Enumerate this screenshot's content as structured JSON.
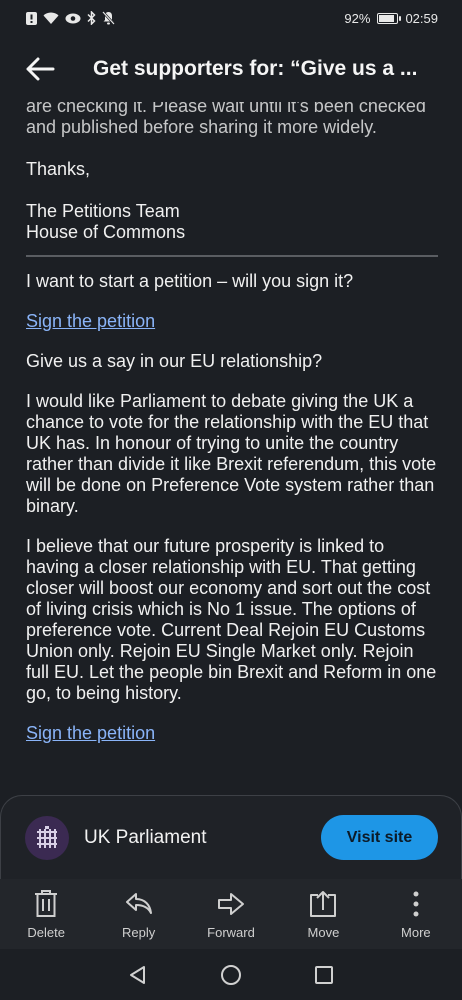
{
  "status_bar": {
    "left_icons": [
      "alert-icon",
      "wifi-icon",
      "eye-icon",
      "bluetooth-icon",
      "mute-bell-icon"
    ],
    "battery_percent": "92%",
    "battery_level": 0.92,
    "time": "02:59"
  },
  "header": {
    "title": "Get supporters for: “Give us a ..."
  },
  "email": {
    "clipped_line": "are checking it. Please wait until it’s been checked and published before sharing it more widely.",
    "thanks": "Thanks,",
    "signoff_line1": "The Petitions Team",
    "signoff_line2": "House of Commons",
    "intro": "I want to start a petition – will you sign it?",
    "link_text": "Sign the petition",
    "petition_title": "Give us a say in our EU relationship?",
    "paragraph1": "I would like Parliament to debate giving the UK a chance to vote for the relationship with the EU that UK has. In honour of trying to unite the country rather than divide it like Brexit referendum, this vote will be done on Preference Vote system rather than binary.",
    "paragraph2": "I believe that our future prosperity is linked to having a closer relationship with EU. That getting closer will boost our economy and sort out the cost of living crisis which is No 1 issue. The options of preference vote. Current Deal Rejoin EU Customs Union only. Rejoin EU Single Market only. Rejoin full EU. Let the people bin Brexit and Reform in one go, to being history.",
    "link_text_2": "Sign the petition"
  },
  "site_card": {
    "name": "UK Parliament",
    "button": "Visit site"
  },
  "toolbar": {
    "items": [
      {
        "label": "Delete",
        "icon": "trash-icon"
      },
      {
        "label": "Reply",
        "icon": "reply-icon"
      },
      {
        "label": "Forward",
        "icon": "forward-icon"
      },
      {
        "label": "Move",
        "icon": "move-icon"
      },
      {
        "label": "More",
        "icon": "more-icon"
      }
    ]
  },
  "nav": {
    "items": [
      "back-triangle-icon",
      "home-circle-icon",
      "recents-square-icon"
    ]
  },
  "colors": {
    "background": "#1c1f24",
    "accent": "#1e96e6",
    "link": "#8ab4f8"
  }
}
